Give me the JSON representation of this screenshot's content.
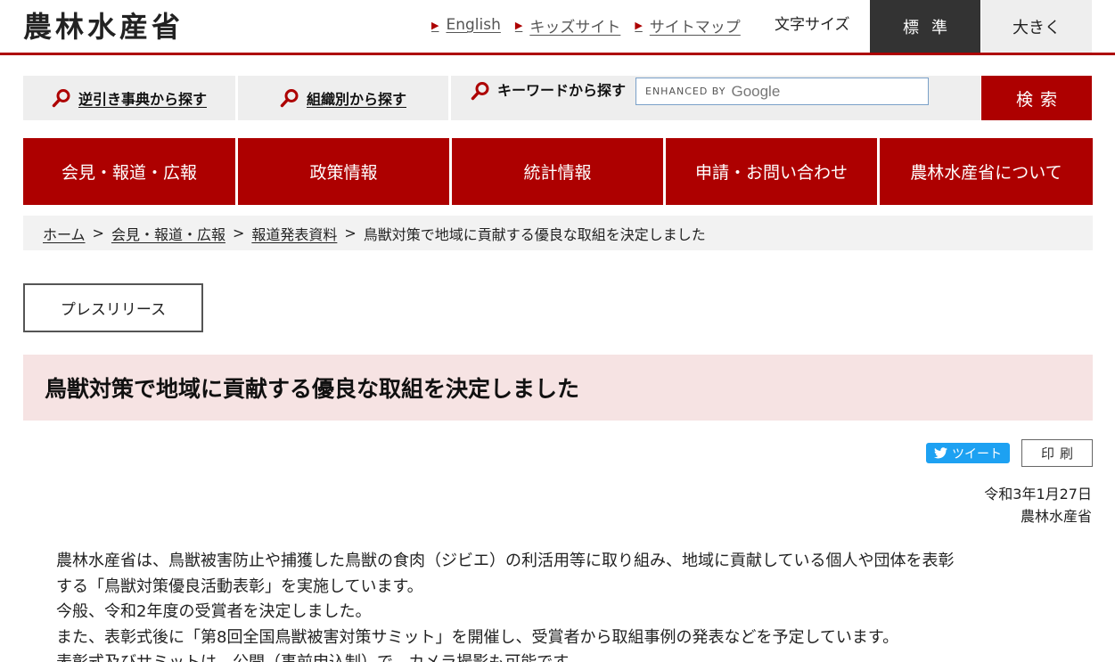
{
  "header": {
    "logo": "農林水産省",
    "links": [
      {
        "label": "English"
      },
      {
        "label": "キッズサイト"
      },
      {
        "label": "サイトマップ"
      }
    ],
    "font_size_label": "文字サイズ",
    "font_size_standard": "標準",
    "font_size_large": "大きく"
  },
  "search": {
    "reverse_dictionary": "逆引き事典から探す",
    "by_organization": "組織別から探す",
    "keyword_label": "キーワードから探す",
    "enhanced_by": "ENHANCED BY",
    "google": "Google",
    "button": "検索"
  },
  "nav": [
    {
      "label": "会見・報道・広報"
    },
    {
      "label": "政策情報"
    },
    {
      "label": "統計情報"
    },
    {
      "label": "申請・お問い合わせ"
    },
    {
      "label": "農林水産省について"
    }
  ],
  "breadcrumb": [
    {
      "label": "ホーム"
    },
    {
      "label": "会見・報道・広報"
    },
    {
      "label": "報道発表資料"
    },
    {
      "label": "鳥獣対策で地域に貢献する優良な取組を決定しました"
    }
  ],
  "breadcrumb_sep": ">",
  "press_badge": "プレスリリース",
  "title": "鳥獣対策で地域に貢献する優良な取組を決定しました",
  "share": {
    "tweet": "ツイート",
    "print": "印刷"
  },
  "meta": {
    "date": "令和3年1月27日",
    "org": "農林水産省"
  },
  "body": [
    "農林水産省は、鳥獣被害防止や捕獲した鳥獣の食肉（ジビエ）の利活用等に取り組み、地域に貢献している個人や団体を表彰",
    "する「鳥獣対策優良活動表彰」を実施しています。",
    "今般、令和2年度の受賞者を決定しました。",
    "また、表彰式後に「第8回全国鳥獣被害対策サミット」を開催し、受賞者から取組事例の発表などを予定しています。",
    "表彰式及びサミットは、公開（事前申込制）で、カメラ撮影も可能です。"
  ],
  "colors": {
    "brand_red": "#ad0000",
    "title_bg": "#f6e3e3",
    "twitter_blue": "#1da1f2"
  }
}
